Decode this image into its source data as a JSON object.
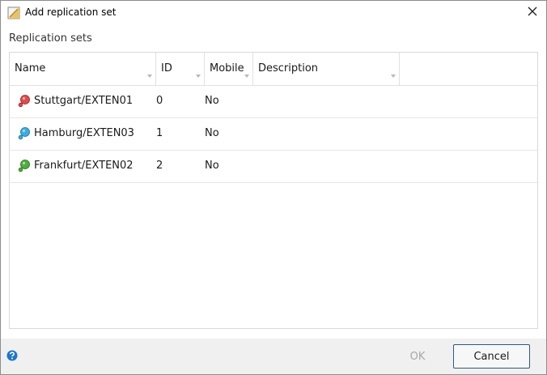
{
  "window": {
    "title": "Add replication set"
  },
  "section": {
    "label": "Replication sets"
  },
  "table": {
    "columns": [
      "Name",
      "ID",
      "Mobile",
      "Description"
    ],
    "rows": [
      {
        "name": "Stuttgart/EXTEN01",
        "id": "0",
        "mobile": "No",
        "description": "",
        "pin_color": "#e04b4b"
      },
      {
        "name": "Hamburg/EXTEN03",
        "id": "1",
        "mobile": "No",
        "description": "",
        "pin_color": "#3aaee0"
      },
      {
        "name": "Frankfurt/EXTEN02",
        "id": "2",
        "mobile": "No",
        "description": "",
        "pin_color": "#4caf3c"
      }
    ]
  },
  "footer": {
    "ok_label": "OK",
    "cancel_label": "Cancel"
  },
  "colors": {
    "accent": "#1e78c8",
    "ok_disabled": "#a6a6a6"
  },
  "icons": {
    "app": "dialog-icon",
    "close": "close-icon",
    "help": "help-icon"
  }
}
